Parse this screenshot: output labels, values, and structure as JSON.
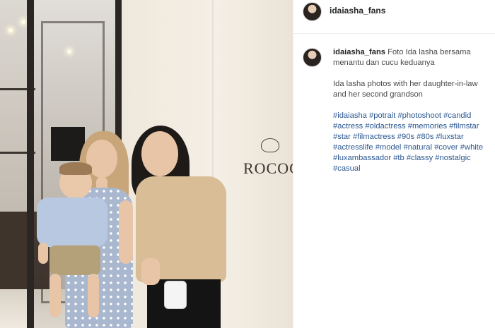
{
  "header": {
    "username": "idaiasha_fans"
  },
  "caption": {
    "username": "idaiasha_fans",
    "text": "Foto Ida lasha bersama menantu dan cucu keduanya",
    "translation": "Ida lasha photos with her daughter-in-law and her second grandson",
    "hashtags": [
      "#idaiasha",
      "#potrait",
      "#photoshoot",
      "#candid",
      "#actress",
      "#oldactress",
      "#memories",
      "#filmstar",
      "#star",
      "#filmactress",
      "#90s",
      "#80s",
      "#luxstar",
      "#actresslife",
      "#model",
      "#natural",
      "#cover",
      "#white",
      "#luxambassador",
      "#tb",
      "#classy",
      "#nostalgic",
      "#casual"
    ]
  },
  "photo": {
    "store_sign": "ROCOC"
  },
  "colors": {
    "hashtag": "#2a5690",
    "divider": "#efefef",
    "text": "#262626"
  }
}
